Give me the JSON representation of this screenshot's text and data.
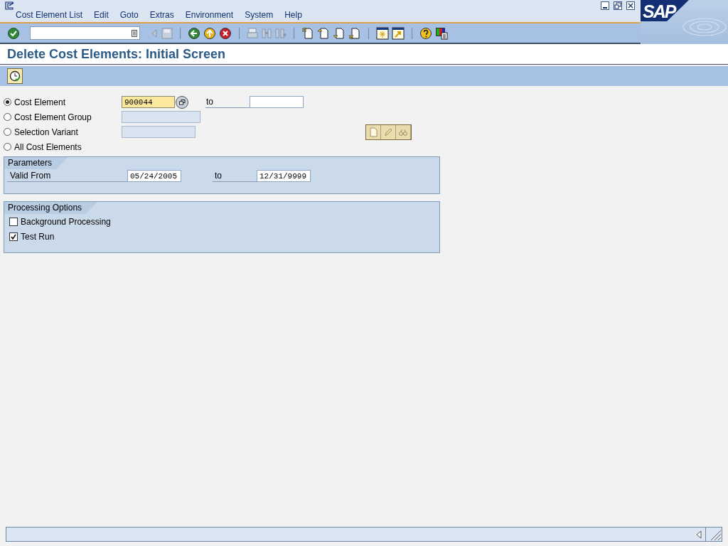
{
  "menu": {
    "items": [
      "Cost Element List",
      "Edit",
      "Goto",
      "Extras",
      "Environment",
      "System",
      "Help"
    ],
    "logo": "SAP"
  },
  "title": "Delete Cost Elements: Initial Screen",
  "selection": {
    "options": [
      {
        "label": "Cost Element",
        "selected": true,
        "kind": "range",
        "value": "900044",
        "to_label": "to"
      },
      {
        "label": "Cost Element Group",
        "selected": false,
        "kind": "single",
        "disabled": true
      },
      {
        "label": "Selection Variant",
        "selected": false,
        "kind": "variant",
        "disabled": true
      },
      {
        "label": "All Cost Elements",
        "selected": false,
        "kind": "none"
      }
    ]
  },
  "parameters": {
    "title": "Parameters",
    "rows": [
      {
        "label": "Valid From",
        "from": "05/24/2005",
        "to_label": "to",
        "to": "12/31/9999"
      }
    ]
  },
  "processing": {
    "title": "Processing Options",
    "checkboxes": [
      {
        "label": "Background Processing",
        "checked": false
      },
      {
        "label": "Test Run",
        "checked": true
      }
    ]
  }
}
